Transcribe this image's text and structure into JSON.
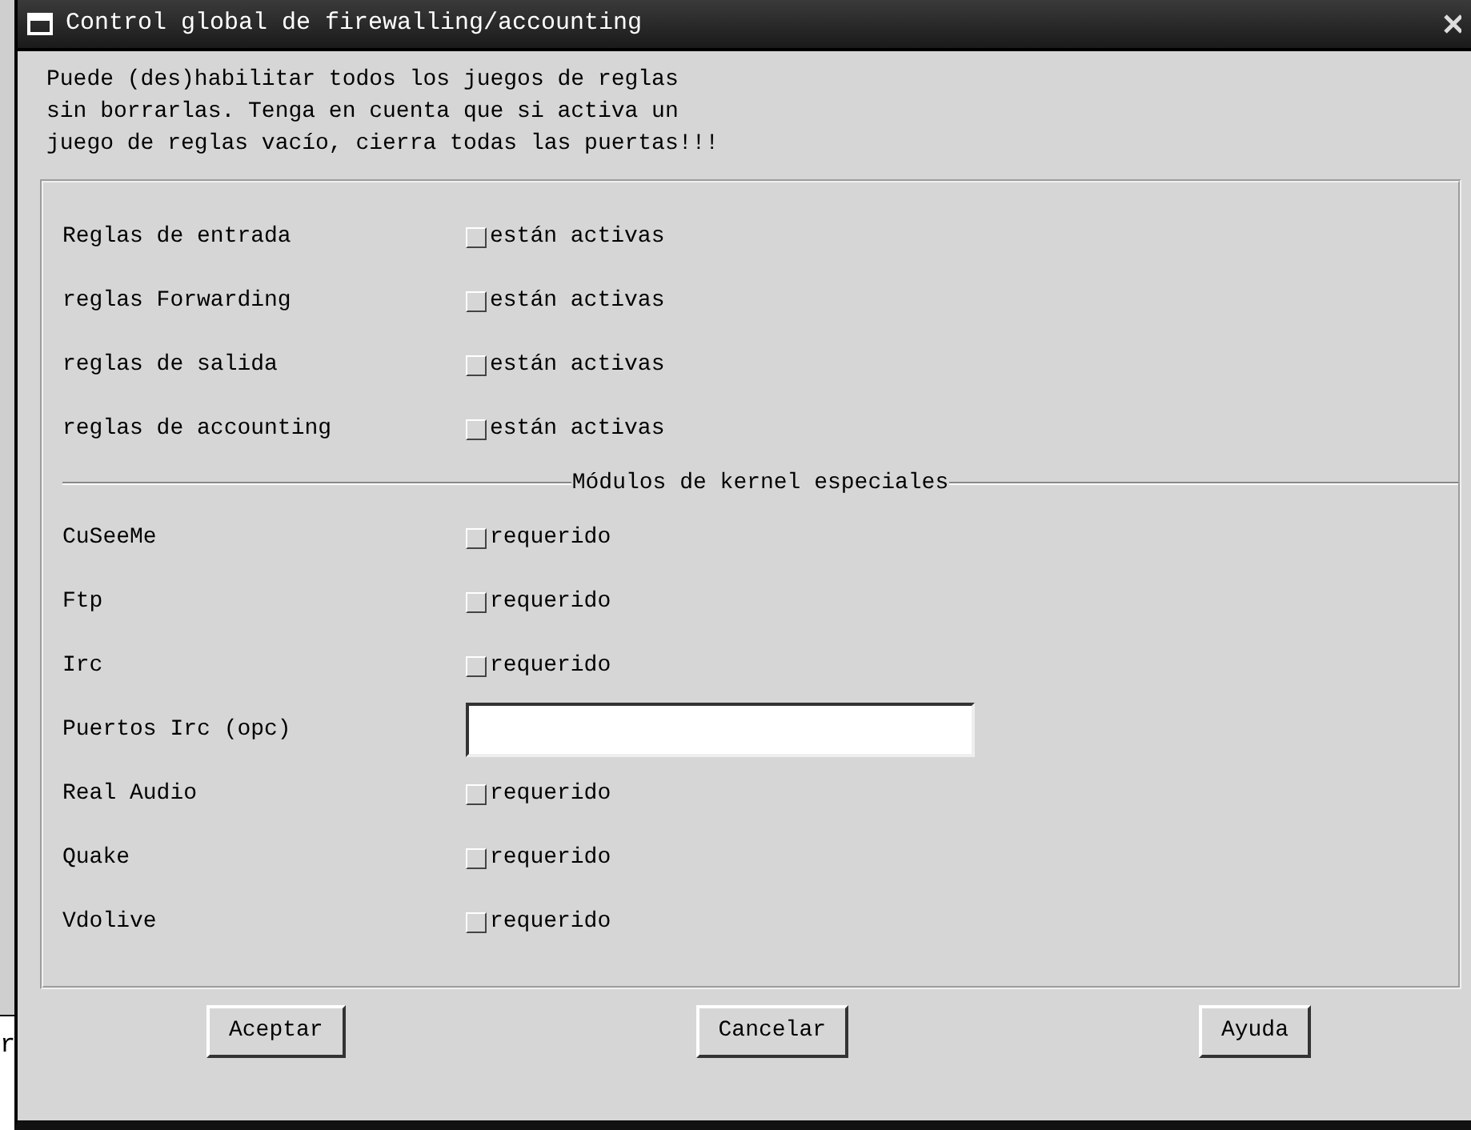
{
  "background_fragment": "r",
  "window": {
    "title": "Control global de firewalling/accounting"
  },
  "description": "Puede (des)habilitar todos los juegos de reglas\nsin borrarlas. Tenga en cuenta que si activa un\njuego de reglas vacío, cierra todas las puertas!!!",
  "rules": [
    {
      "label": "Reglas de entrada",
      "checkbox_label": "están activas",
      "checked": false
    },
    {
      "label": "reglas Forwarding",
      "checkbox_label": "están activas",
      "checked": false
    },
    {
      "label": "reglas de salida",
      "checkbox_label": "están activas",
      "checked": false
    },
    {
      "label": "reglas de accounting",
      "checkbox_label": "están activas",
      "checked": false
    }
  ],
  "modules_heading": "Módulos de kernel especiales",
  "modules": [
    {
      "kind": "checkbox",
      "label": "CuSeeMe",
      "checkbox_label": "requerido",
      "checked": false
    },
    {
      "kind": "checkbox",
      "label": "Ftp",
      "checkbox_label": "requerido",
      "checked": false
    },
    {
      "kind": "checkbox",
      "label": "Irc",
      "checkbox_label": "requerido",
      "checked": false
    },
    {
      "kind": "field",
      "label": "Puertos Irc (opc)"
    },
    {
      "kind": "checkbox",
      "label": "Real Audio",
      "checkbox_label": "requerido",
      "checked": false
    },
    {
      "kind": "checkbox",
      "label": "Quake",
      "checkbox_label": "requerido",
      "checked": false
    },
    {
      "kind": "checkbox",
      "label": "Vdolive",
      "checkbox_label": "requerido",
      "checked": false
    }
  ],
  "buttons": [
    "Aceptar",
    "Cancelar",
    "Ayuda"
  ]
}
